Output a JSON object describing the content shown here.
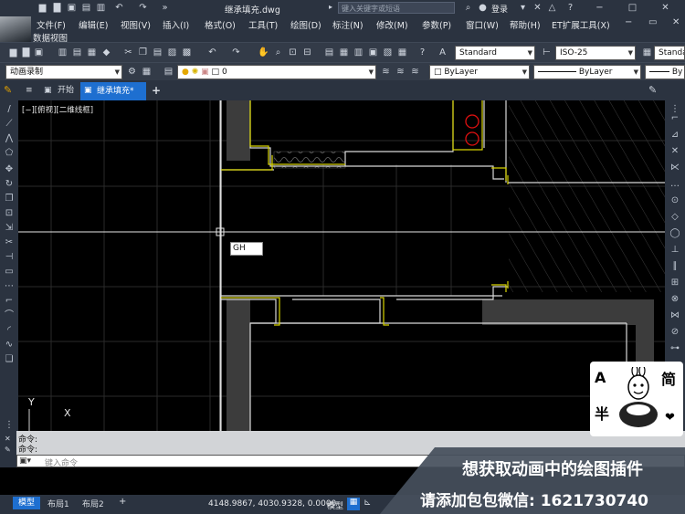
{
  "titlebar": {
    "filename": "继承填充.dwg",
    "search_placeholder": "键入关键字或短语",
    "login": "登录"
  },
  "menu": [
    "文件(F)",
    "编辑(E)",
    "视图(V)",
    "插入(I)",
    "格式(O)",
    "工具(T)",
    "绘图(D)",
    "标注(N)",
    "修改(M)",
    "参数(P)",
    "窗口(W)",
    "帮助(H)",
    "ET扩展工具(X)"
  ],
  "menu2": [
    "数据视图"
  ],
  "toolbar": {
    "text_style": "Standard",
    "dim_style": "ISO-25",
    "table_style": "Standard",
    "workspace": "动画录制",
    "layer": "0",
    "color": "ByLayer",
    "linetype": "ByLayer",
    "lineweight": "By"
  },
  "tabs": {
    "menu_icon": "≡",
    "start": "开始",
    "active_doc": "继承填充*",
    "add": "+"
  },
  "viewport": {
    "label": "[−][俯视][二维线框]",
    "input_text": "GH"
  },
  "ucs": {
    "y": "Y",
    "x": "X"
  },
  "command": {
    "history": [
      "命令:",
      "命令:"
    ],
    "placeholder": "键入命令"
  },
  "layouts": [
    "模型",
    "布局1",
    "布局2",
    "+"
  ],
  "status": {
    "coords": "4148.9867, 4030.9328, 0.0000",
    "model": "模型"
  },
  "overlay": {
    "line1": "想获取动画中的绘图插件",
    "line2": "请添加包包微信: 1621730740"
  },
  "sticker": {
    "left_top": "A",
    "left_bottom": "半",
    "right_top": "简",
    "heart": "❤"
  },
  "colors": {
    "accent": "#1e6fd0",
    "wall_yellow": "#d8d400",
    "door_red": "#e01010"
  }
}
